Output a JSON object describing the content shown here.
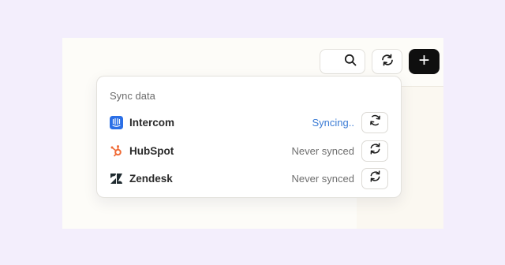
{
  "toolbar": {
    "search_icon": "search-icon",
    "refresh_icon": "refresh-icon",
    "add_label": "+"
  },
  "sync_menu": {
    "title": "Sync data",
    "items": [
      {
        "name": "Intercom",
        "status": "Syncing..",
        "icon": "intercom-logo-icon",
        "status_color": "#3a7bd5"
      },
      {
        "name": "HubSpot",
        "status": "Never synced",
        "icon": "hubspot-logo-icon",
        "status_color": "#6e6e6e"
      },
      {
        "name": "Zendesk",
        "status": "Never synced",
        "icon": "zendesk-logo-icon",
        "status_color": "#6e6e6e"
      }
    ]
  },
  "colors": {
    "background": "#f3eefc",
    "intercom": "#2b6fe6",
    "hubspot": "#f06a35",
    "zendesk": "#1f2a2f",
    "primary_button": "#0f0f0f"
  }
}
